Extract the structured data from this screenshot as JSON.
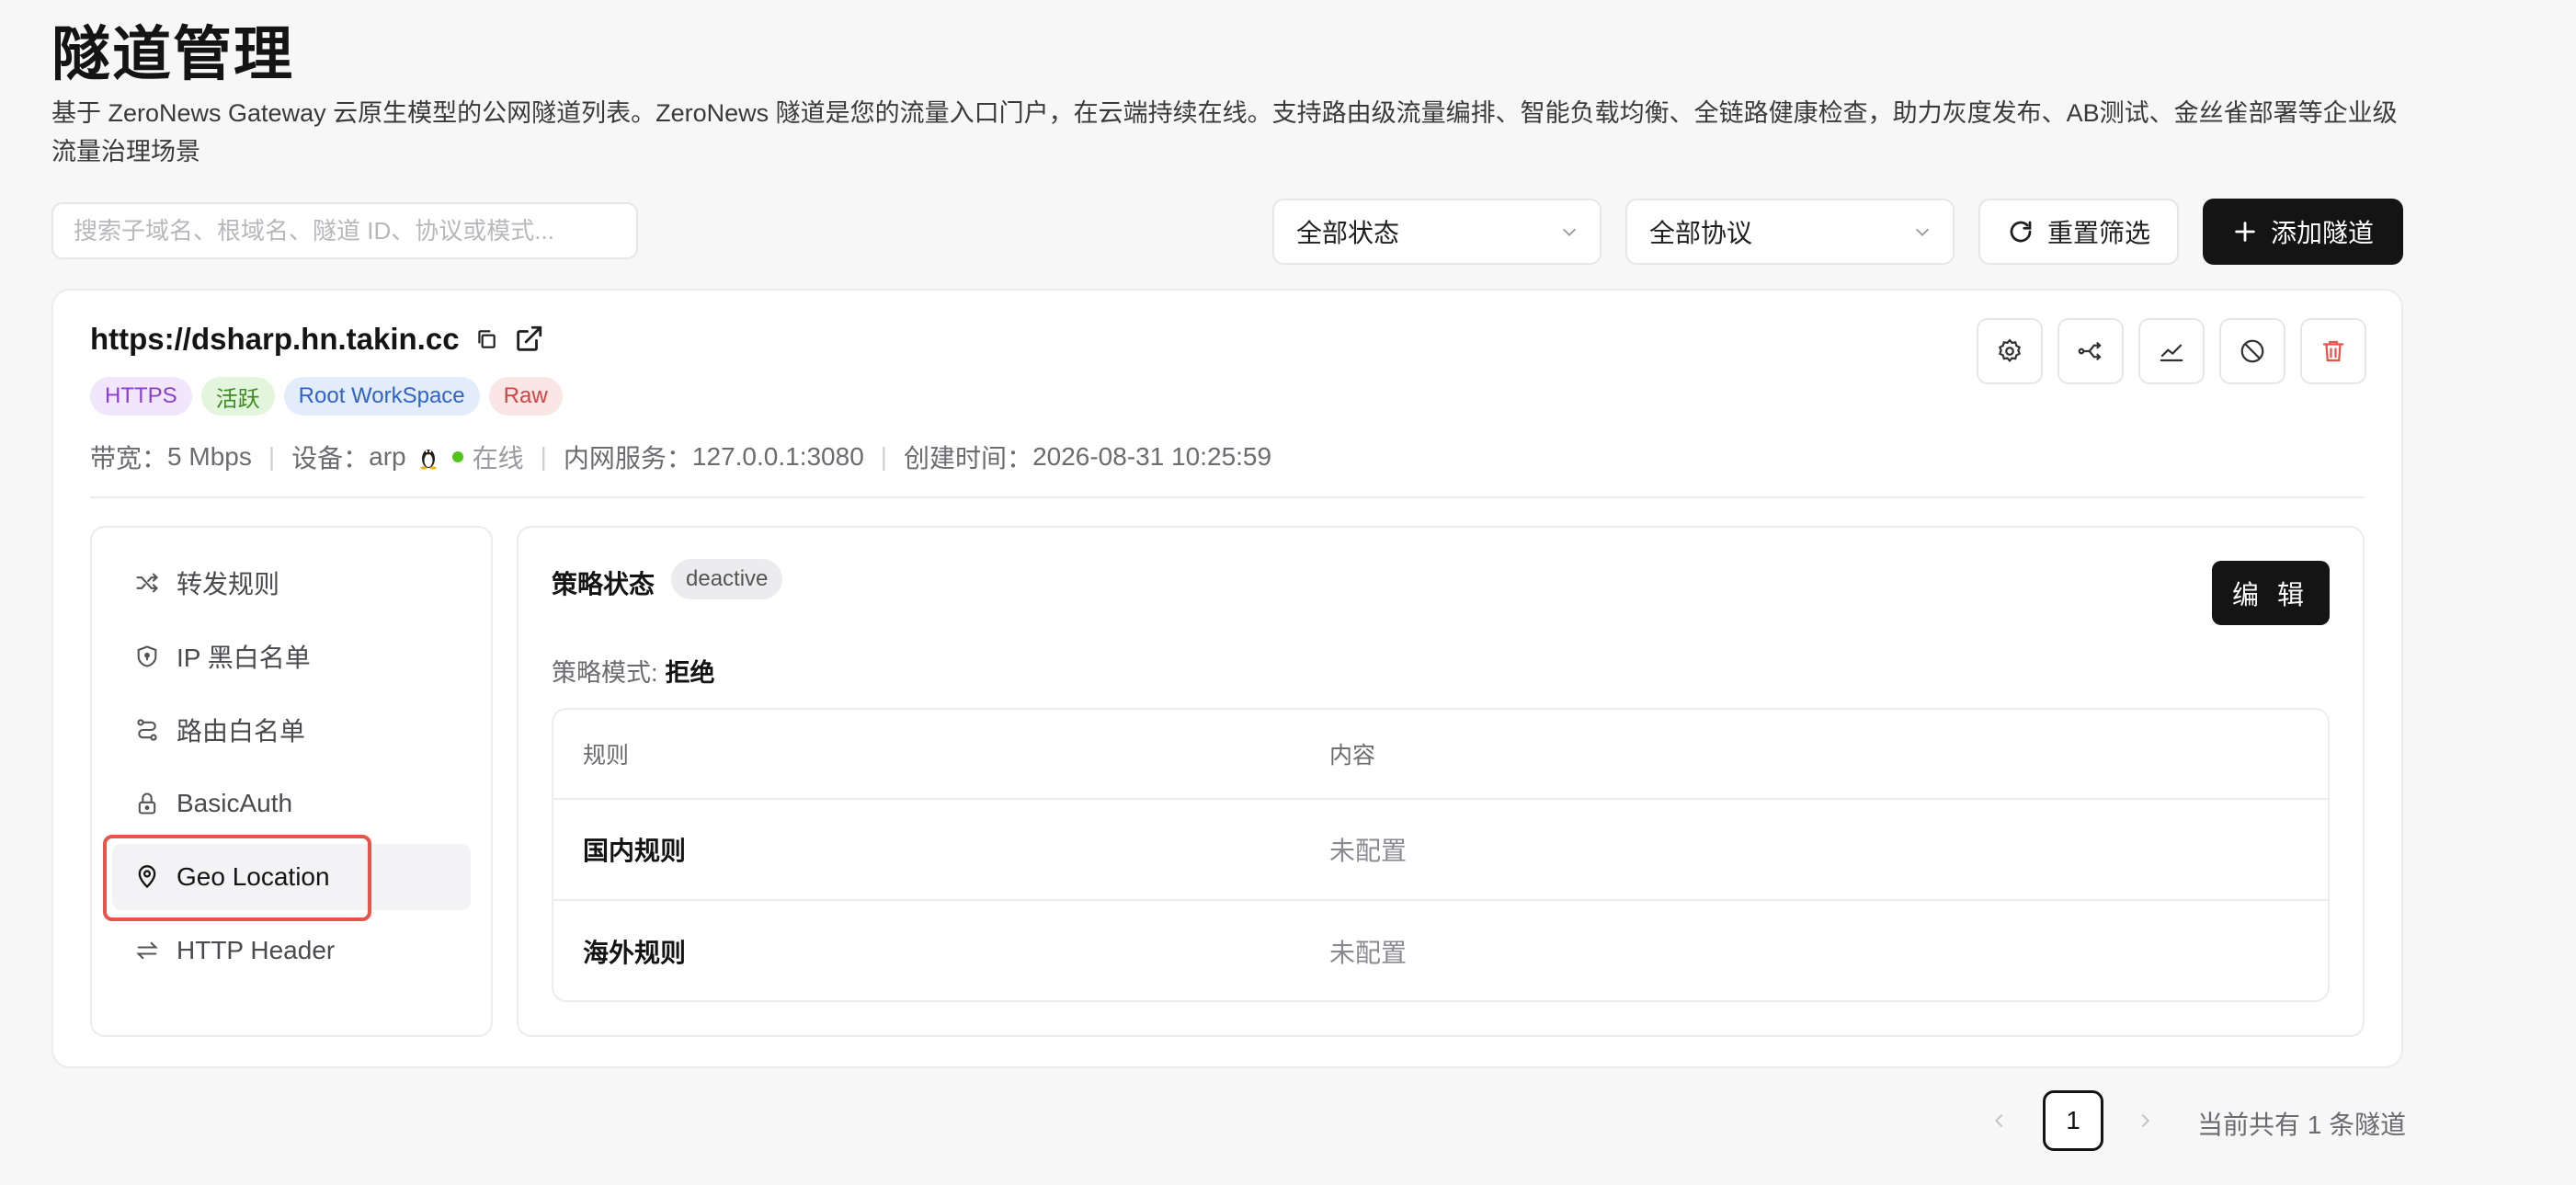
{
  "header": {
    "title": "隧道管理",
    "description": "基于 ZeroNews Gateway 云原生模型的公网隧道列表。ZeroNews 隧道是您的流量入口门户，在云端持续在线。支持路由级流量编排、智能负载均衡、全链路健康检查，助力灰度发布、AB测试、金丝雀部署等企业级流量治理场景"
  },
  "toolbar": {
    "search_placeholder": "搜索子域名、根域名、隧道 ID、协议或模式...",
    "status_select": "全部状态",
    "protocol_select": "全部协议",
    "reset_label": "重置筛选",
    "add_label": "添加隧道"
  },
  "tunnel": {
    "url": "https://dsharp.hn.takin.cc",
    "tags": {
      "protocol": "HTTPS",
      "state": "活跃",
      "workspace": "Root WorkSpace",
      "mode": "Raw"
    },
    "meta": {
      "bandwidth_label": "带宽：",
      "bandwidth": "5 Mbps",
      "device_label": "设备：",
      "device": "arp",
      "online": "在线",
      "service_label": "内网服务：",
      "service": "127.0.0.1:3080",
      "created_label": "创建时间：",
      "created": "2026-08-31 10:25:59"
    },
    "actions": [
      "settings-icon",
      "route-icon",
      "chart-icon",
      "disable-icon",
      "delete-icon"
    ]
  },
  "nav": {
    "items": [
      {
        "label": "转发规则",
        "icon": "shuffle-icon"
      },
      {
        "label": "IP 黑白名单",
        "icon": "shield-icon"
      },
      {
        "label": "路由白名单",
        "icon": "route-icon"
      },
      {
        "label": "BasicAuth",
        "icon": "lock-icon"
      },
      {
        "label": "Geo Location",
        "icon": "map-pin-icon"
      },
      {
        "label": "HTTP Header",
        "icon": "arrows-icon"
      }
    ],
    "active": "Geo Location"
  },
  "panel": {
    "strategy_label": "策略状态",
    "strategy_status": "deactive",
    "edit_label": "编 辑",
    "mode_label": "策略模式:",
    "mode_value": "拒绝",
    "table": {
      "headers": [
        "规则",
        "内容"
      ],
      "rows": [
        {
          "rule": "国内规则",
          "content": "未配置"
        },
        {
          "rule": "海外规则",
          "content": "未配置"
        }
      ]
    }
  },
  "pagination": {
    "current": "1",
    "total_text": "当前共有 1 条隧道"
  },
  "colors": {
    "primary": "#141414",
    "online": "#52c41a",
    "danger": "#e8534a"
  }
}
